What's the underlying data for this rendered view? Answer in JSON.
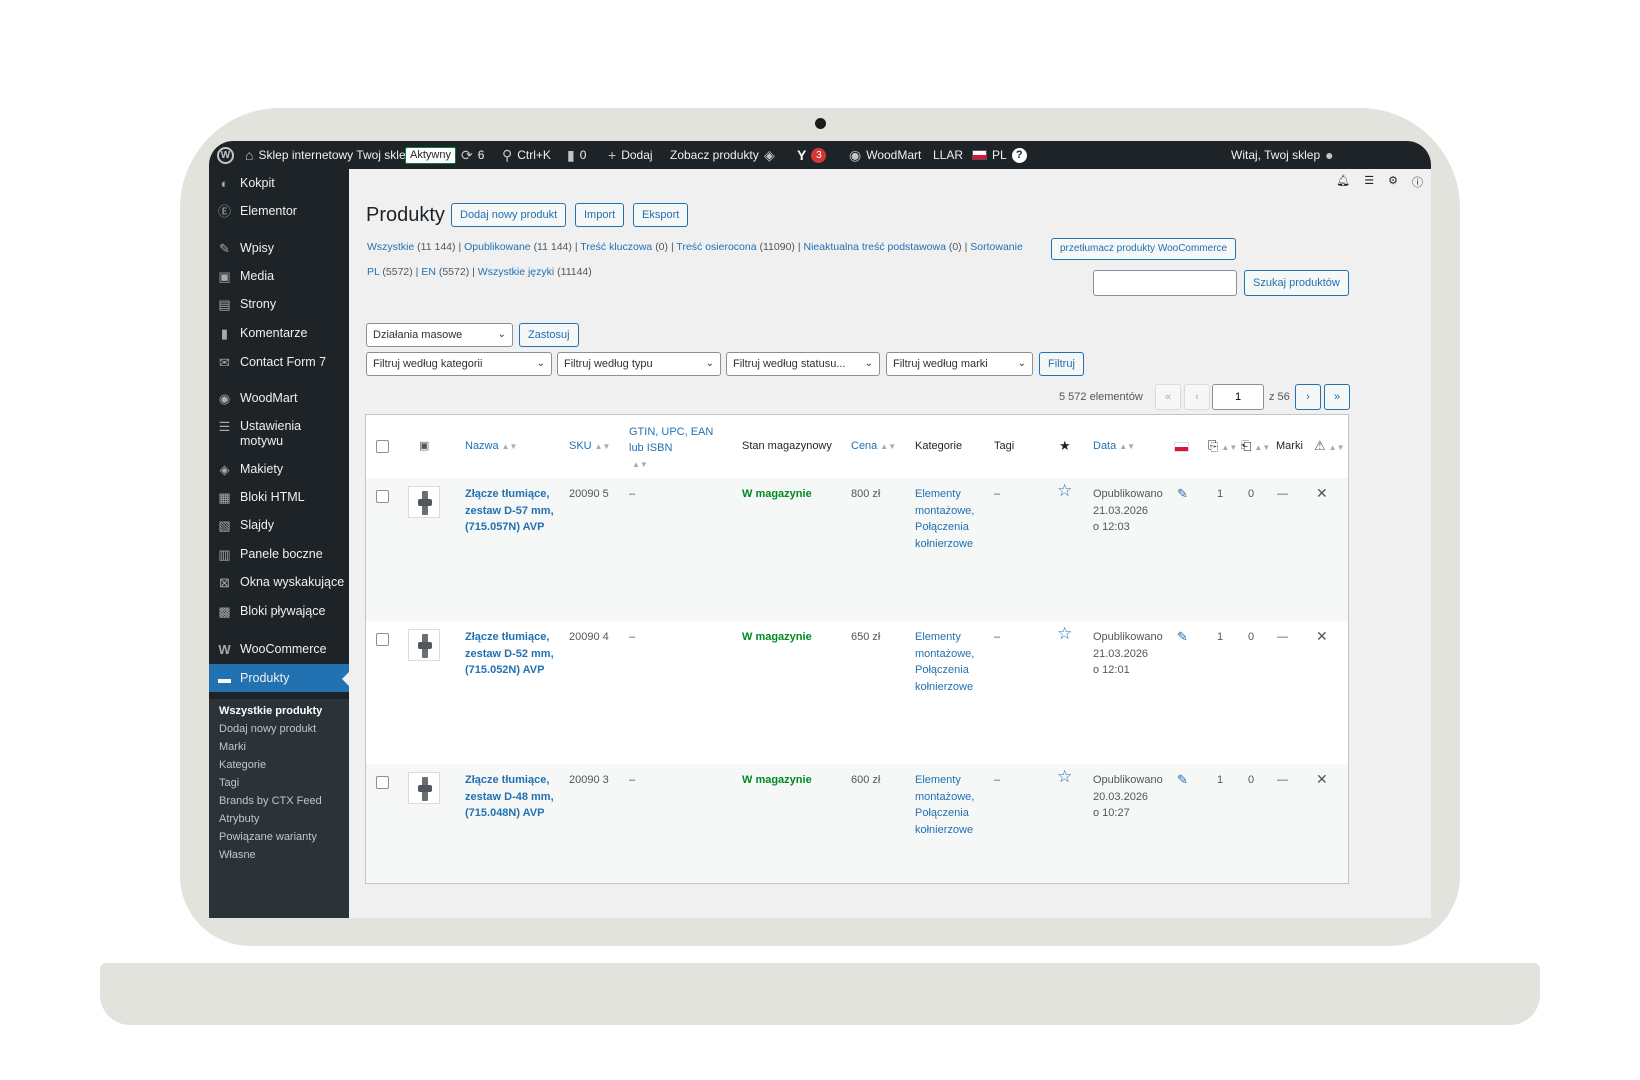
{
  "adminbar": {
    "site_name": "Sklep internetowy Twoj sklep",
    "status_badge": "Aktywny",
    "updates_count": "6",
    "search_shortcut": "Ctrl+K",
    "comments_count": "0",
    "add_label": "Dodaj",
    "view_products": "Zobacz produkty",
    "yoast_count": "3",
    "woodmart": "WoodMart",
    "llar": "LLAR",
    "language": "PL",
    "greeting": "Witaj, Twoj sklep"
  },
  "sidebar": {
    "items": [
      {
        "label": "Kokpit",
        "icon": "dashboard-icon"
      },
      {
        "label": "Elementor",
        "icon": "elementor-icon"
      },
      {
        "label": "Wpisy",
        "icon": "pin-icon"
      },
      {
        "label": "Media",
        "icon": "media-icon"
      },
      {
        "label": "Strony",
        "icon": "pages-icon"
      },
      {
        "label": "Komentarze",
        "icon": "comment-icon"
      },
      {
        "label": "Contact Form 7",
        "icon": "mail-icon"
      },
      {
        "label": "WoodMart",
        "icon": "woodmart-icon"
      },
      {
        "label": "Ustawienia motywu",
        "icon": "sliders-icon"
      },
      {
        "label": "Makiety",
        "icon": "layers-icon"
      },
      {
        "label": "Bloki HTML",
        "icon": "html-block-icon"
      },
      {
        "label": "Slajdy",
        "icon": "slides-icon"
      },
      {
        "label": "Panele boczne",
        "icon": "sidebar-panel-icon"
      },
      {
        "label": "Okna wyskakujące",
        "icon": "popup-icon"
      },
      {
        "label": "Bloki pływające",
        "icon": "floating-block-icon"
      },
      {
        "label": "WooCommerce",
        "icon": "woocommerce-icon"
      },
      {
        "label": "Produkty",
        "icon": "products-icon"
      }
    ],
    "submenu": [
      "Wszystkie produkty",
      "Dodaj nowy produkt",
      "Marki",
      "Kategorie",
      "Tagi",
      "Brands by CTX Feed",
      "Atrybuty",
      "Powiązane warianty",
      "Własne"
    ]
  },
  "header": {
    "title": "Produkty",
    "add_new": "Dodaj nowy produkt",
    "import": "Import",
    "export": "Eksport"
  },
  "views": {
    "all": "Wszystkie",
    "all_count": "(11 144)",
    "published": "Opublikowane",
    "published_count": "(11 144)",
    "cornerstone": "Treść kluczowa",
    "cornerstone_count": "(0)",
    "orphaned": "Treść osierocona",
    "orphaned_count": "(11090)",
    "stale": "Nieaktualna treść podstawowa",
    "stale_count": "(0)",
    "sorting": "Sortowanie",
    "translate_button": "przetłumacz produkty WooCommerce",
    "lang_pl": "PL",
    "lang_pl_count": "(5572)",
    "lang_en": "EN",
    "lang_en_count": "(5572)",
    "lang_all": "Wszystkie języki",
    "lang_all_count": "(11144)"
  },
  "search": {
    "value": "",
    "button": "Szukaj produktów"
  },
  "bulk": {
    "select": "Działania masowe",
    "apply": "Zastosuj"
  },
  "filters": {
    "category": "Filtruj według kategorii",
    "type": "Filtruj według typu",
    "status": "Filtruj według statusu...",
    "brand": "Filtruj według marki",
    "button": "Filtruj"
  },
  "pagination": {
    "count": "5 572 elementów",
    "first": "«",
    "prev": "‹",
    "current": "1",
    "of": "z 56",
    "next": "›",
    "last": "»"
  },
  "table": {
    "columns": {
      "name": "Nazwa",
      "sku": "SKU",
      "gtin": "GTIN, UPC, EAN lub ISBN",
      "stock": "Stan magazynowy",
      "price": "Cena",
      "categories": "Kategorie",
      "tags": "Tagi",
      "date": "Data",
      "brands": "Marki"
    },
    "rows": [
      {
        "name": "Złącze tłumiące, zestaw D-57 mm, (715.057N) AVP",
        "sku": "20090 5",
        "gtin": "–",
        "stock": "W magazynie",
        "price": "800 zł",
        "categories": "Elementy montażowe, Połączenia kołnierzowe",
        "tags": "–",
        "status": "Opublikowano",
        "date": "21.03.2026",
        "time": "o 12:03",
        "col1": "1",
        "col2": "0",
        "brands": "—"
      },
      {
        "name": "Złącze tłumiące, zestaw D-52 mm, (715.052N) AVP",
        "sku": "20090 4",
        "gtin": "–",
        "stock": "W magazynie",
        "price": "650 zł",
        "categories": "Elementy montażowe, Połączenia kołnierzowe",
        "tags": "–",
        "status": "Opublikowano",
        "date": "21.03.2026",
        "time": "o 12:01",
        "col1": "1",
        "col2": "0",
        "brands": "—"
      },
      {
        "name": "Złącze tłumiące, zestaw D-48 mm, (715.048N) AVP",
        "sku": "20090 3",
        "gtin": "–",
        "stock": "W magazynie",
        "price": "600 zł",
        "categories": "Elementy montażowe, Połączenia kołnierzowe",
        "tags": "–",
        "status": "Opublikowano",
        "date": "20.03.2026",
        "time": "o 10:27",
        "col1": "1",
        "col2": "0",
        "brands": "—"
      }
    ]
  }
}
